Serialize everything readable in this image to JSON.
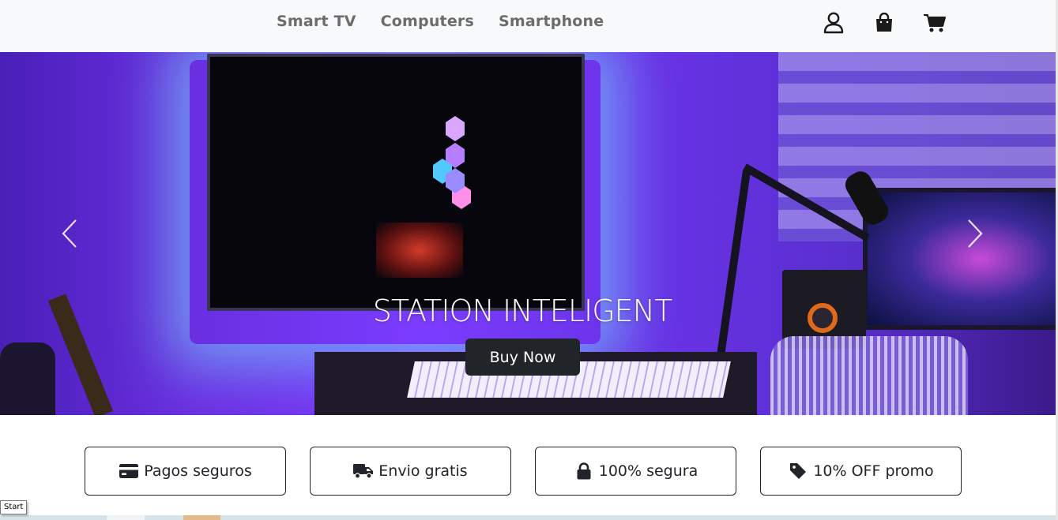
{
  "nav": {
    "links": [
      "Smart TV",
      "Computers",
      "Smartphone"
    ],
    "icons": [
      "user-icon",
      "shopping-bag-icon",
      "cart-icon"
    ]
  },
  "hero": {
    "title": "STATION INTELIGENT",
    "button_label": "Buy Now",
    "prev_icon": "chevron-left-icon",
    "next_icon": "chevron-right-icon"
  },
  "features": [
    {
      "icon": "credit-card-icon",
      "label": "Pagos seguros"
    },
    {
      "icon": "truck-icon",
      "label": "Envio gratis"
    },
    {
      "icon": "lock-icon",
      "label": "100% segura"
    },
    {
      "icon": "tag-icon",
      "label": "10% OFF promo"
    }
  ],
  "tooltip": {
    "text": "Start"
  },
  "colors": {
    "navbar_bg": "#f8f9fa",
    "nav_text": "#6c6c6c",
    "button_bg": "#212529",
    "hero_purple": "#7b3cff"
  }
}
